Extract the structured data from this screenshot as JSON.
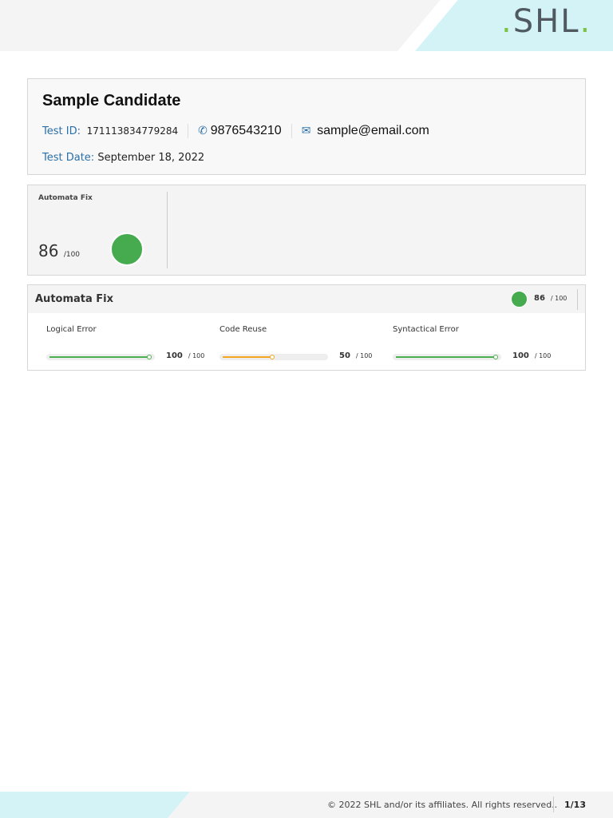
{
  "brand": {
    "logo": "SHL"
  },
  "candidate": {
    "name": "Sample Candidate",
    "test_id_label": "Test ID:",
    "test_id": "171113834779284",
    "phone": "9876543210",
    "email": "sample@email.com",
    "test_date_label": "Test Date:",
    "test_date": "September 18, 2022"
  },
  "summary": {
    "title": "Automata Fix",
    "score": "86",
    "max": "/100",
    "percent": 86
  },
  "section": {
    "title": "Automata Fix",
    "score": "86",
    "max": "/ 100",
    "skills": [
      {
        "name": "Logical Error",
        "score": "100",
        "max": "/ 100",
        "percent": 100,
        "color": "#4caf50"
      },
      {
        "name": "Code Reuse",
        "score": "50",
        "max": "/ 100",
        "percent": 50,
        "color": "#f5a623"
      },
      {
        "name": "Syntactical Error",
        "score": "100",
        "max": "/ 100",
        "percent": 100,
        "color": "#4caf50"
      }
    ]
  },
  "footer": {
    "copyright": "© 2022 SHL and/or its affiliates. All rights reserved..",
    "page": "1/13"
  }
}
